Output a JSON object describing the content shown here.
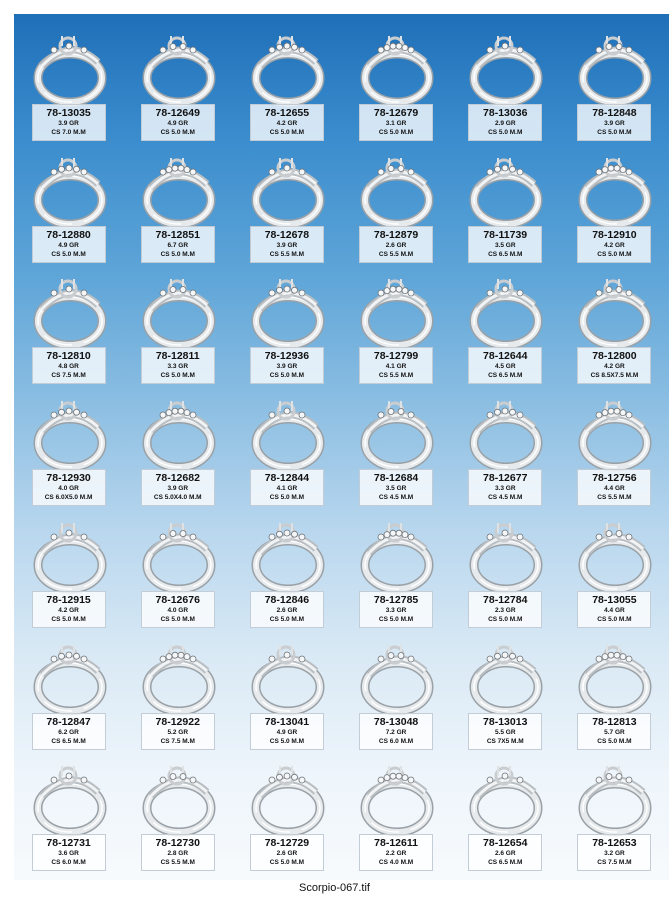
{
  "rings": [
    {
      "code": "78-13035",
      "weight": "3.9 GR",
      "stone": "CS 7.0 M.M"
    },
    {
      "code": "78-12649",
      "weight": "4.9 GR",
      "stone": "CS 5.0 M.M"
    },
    {
      "code": "78-12655",
      "weight": "4.2 GR",
      "stone": "CS 5.0 M.M"
    },
    {
      "code": "78-12679",
      "weight": "3.1 GR",
      "stone": "CS 5.0 M.M"
    },
    {
      "code": "78-13036",
      "weight": "2.9 GR",
      "stone": "CS 5.0 M.M"
    },
    {
      "code": "78-12848",
      "weight": "3.9 GR",
      "stone": "CS 5.0 M.M"
    },
    {
      "code": "78-12880",
      "weight": "4.9 GR",
      "stone": "CS 5.0 M.M"
    },
    {
      "code": "78-12851",
      "weight": "6.7 GR",
      "stone": "CS 5.0 M.M"
    },
    {
      "code": "78-12678",
      "weight": "3.9 GR",
      "stone": "CS 5.5 M.M"
    },
    {
      "code": "78-12879",
      "weight": "2.6 GR",
      "stone": "CS 5.5 M.M"
    },
    {
      "code": "78-11739",
      "weight": "3.5 GR",
      "stone": "CS 6.5 M.M"
    },
    {
      "code": "78-12910",
      "weight": "4.2 GR",
      "stone": "CS 5.0 M.M"
    },
    {
      "code": "78-12810",
      "weight": "4.8 GR",
      "stone": "CS 7.5 M.M"
    },
    {
      "code": "78-12811",
      "weight": "3.3 GR",
      "stone": "CS 5.0 M.M"
    },
    {
      "code": "78-12936",
      "weight": "3.9 GR",
      "stone": "CS 5.0 M.M"
    },
    {
      "code": "78-12799",
      "weight": "4.1 GR",
      "stone": "CS 5.5 M.M"
    },
    {
      "code": "78-12644",
      "weight": "4.5 GR",
      "stone": "CS 6.5 M.M"
    },
    {
      "code": "78-12800",
      "weight": "4.2 GR",
      "stone": "CS 8.5X7.5 M.M"
    },
    {
      "code": "78-12930",
      "weight": "4.0 GR",
      "stone": "CS 6.0X5.0 M.M"
    },
    {
      "code": "78-12682",
      "weight": "3.9 GR",
      "stone": "CS 5.0X4.0 M.M"
    },
    {
      "code": "78-12844",
      "weight": "4.1 GR",
      "stone": "CS 5.0 M.M"
    },
    {
      "code": "78-12684",
      "weight": "3.5 GR",
      "stone": "CS 4.5 M.M"
    },
    {
      "code": "78-12677",
      "weight": "3.3 GR",
      "stone": "CS 4.5 M.M"
    },
    {
      "code": "78-12756",
      "weight": "4.4 GR",
      "stone": "CS 5.5 M.M"
    },
    {
      "code": "78-12915",
      "weight": "4.2 GR",
      "stone": "CS 5.0 M.M"
    },
    {
      "code": "78-12676",
      "weight": "4.0 GR",
      "stone": "CS 5.0 M.M"
    },
    {
      "code": "78-12846",
      "weight": "2.6 GR",
      "stone": "CS 5.0 M.M"
    },
    {
      "code": "78-12785",
      "weight": "3.3 GR",
      "stone": "CS 5.0 M.M"
    },
    {
      "code": "78-12784",
      "weight": "2.3 GR",
      "stone": "CS 5.0 M.M"
    },
    {
      "code": "78-13055",
      "weight": "4.4 GR",
      "stone": "CS 5.0 M.M"
    },
    {
      "code": "78-12847",
      "weight": "6.2 GR",
      "stone": "CS 6.5 M.M"
    },
    {
      "code": "78-12922",
      "weight": "5.2 GR",
      "stone": "CS 7.5 M.M"
    },
    {
      "code": "78-13041",
      "weight": "4.9 GR",
      "stone": "CS 5.0 M.M"
    },
    {
      "code": "78-13048",
      "weight": "7.2 GR",
      "stone": "CS 6.0 M.M"
    },
    {
      "code": "78-13013",
      "weight": "5.5 GR",
      "stone": "CS 7X5 M.M"
    },
    {
      "code": "78-12813",
      "weight": "5.7 GR",
      "stone": "CS 5.0 M.M"
    },
    {
      "code": "78-12731",
      "weight": "3.6 GR",
      "stone": "CS 6.0 M.M"
    },
    {
      "code": "78-12730",
      "weight": "2.8 GR",
      "stone": "CS 5.5 M.M"
    },
    {
      "code": "78-12729",
      "weight": "2.6 GR",
      "stone": "CS 5.0 M.M"
    },
    {
      "code": "78-12611",
      "weight": "2.2 GR",
      "stone": "CS 4.0 M.M"
    },
    {
      "code": "78-12654",
      "weight": "2.6 GR",
      "stone": "CS 6.5 M.M"
    },
    {
      "code": "78-12653",
      "weight": "3.2 GR",
      "stone": "CS 7.5 M.M"
    }
  ],
  "filename": "Scorpio-067.tif",
  "colors": {
    "background_top": "#1f6fb8",
    "background_bottom": "#f7fafd",
    "metal": "#d8dcdf"
  }
}
